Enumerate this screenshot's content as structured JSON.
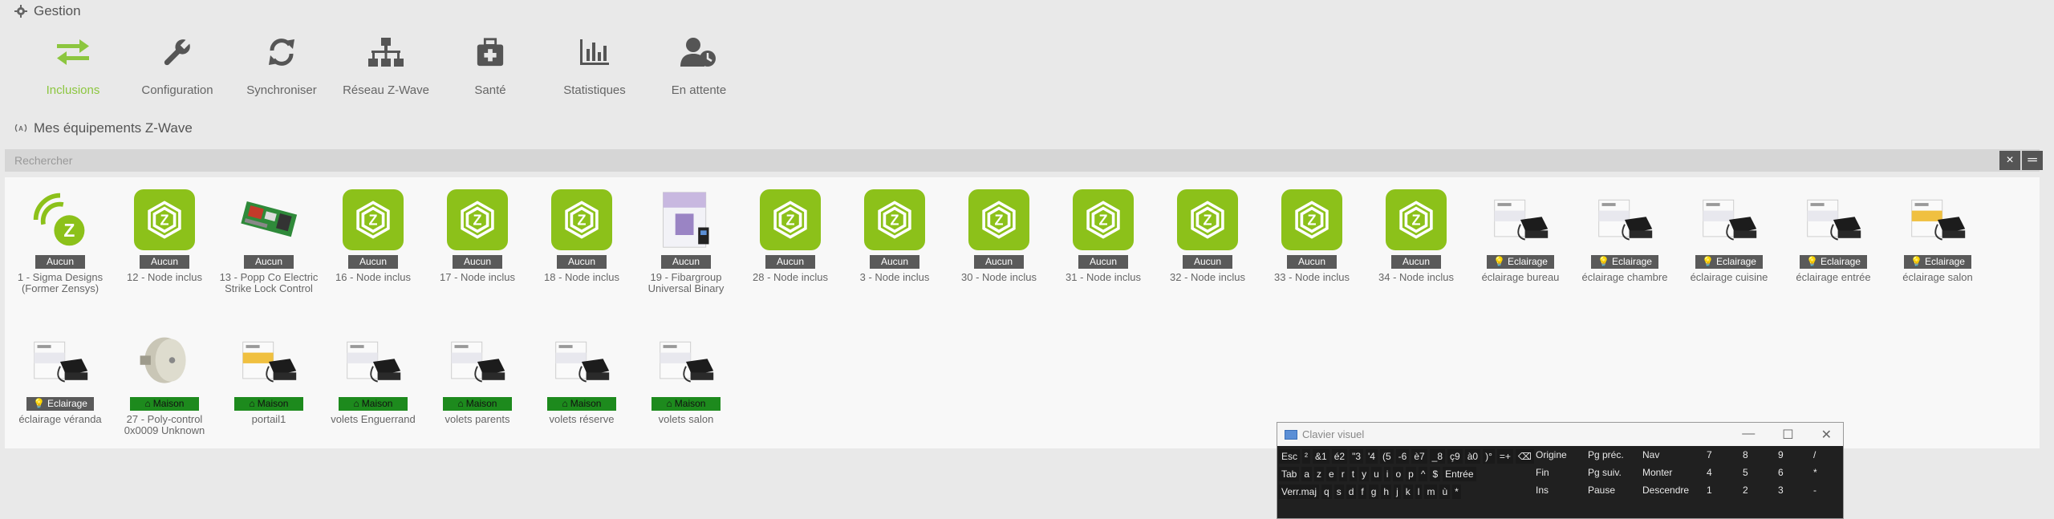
{
  "gestion": {
    "title": "Gestion",
    "items": [
      {
        "label": "Inclusions",
        "icon": "arrows-exchange-icon",
        "active": true
      },
      {
        "label": "Configuration",
        "icon": "wrench-icon"
      },
      {
        "label": "Synchroniser",
        "icon": "sync-icon"
      },
      {
        "label": "Réseau Z-Wave",
        "icon": "network-icon"
      },
      {
        "label": "Santé",
        "icon": "medkit-icon"
      },
      {
        "label": "Statistiques",
        "icon": "bar-chart-icon"
      },
      {
        "label": "En attente",
        "icon": "user-clock-icon"
      }
    ]
  },
  "equipements": {
    "title": "Mes équipements Z-Wave",
    "search_placeholder": "Rechercher",
    "clear_icon": "×",
    "menu_icon": "═"
  },
  "devices_row1": [
    {
      "name": "1 - Sigma Designs (Former Zensys)",
      "badge": "Aucun",
      "img": "sigma"
    },
    {
      "name": "12 - Node inclus",
      "badge": "Aucun",
      "img": "zwave"
    },
    {
      "name": "13 - Popp Co Electric Strike Lock Control",
      "badge": "Aucun",
      "img": "pcb"
    },
    {
      "name": "16 - Node inclus",
      "badge": "Aucun",
      "img": "zwave"
    },
    {
      "name": "17 - Node inclus",
      "badge": "Aucun",
      "img": "zwave"
    },
    {
      "name": "18 - Node inclus",
      "badge": "Aucun",
      "img": "zwave"
    },
    {
      "name": "19 - Fibargroup Universal Binary",
      "badge": "Aucun",
      "img": "fibaro-box"
    },
    {
      "name": "28 - Node inclus",
      "badge": "Aucun",
      "img": "zwave"
    },
    {
      "name": "3 - Node inclus",
      "badge": "Aucun",
      "img": "zwave"
    },
    {
      "name": "30 - Node inclus",
      "badge": "Aucun",
      "img": "zwave"
    },
    {
      "name": "31 - Node inclus",
      "badge": "Aucun",
      "img": "zwave"
    },
    {
      "name": "32 - Node inclus",
      "badge": "Aucun",
      "img": "zwave"
    },
    {
      "name": "33 - Node inclus",
      "badge": "Aucun",
      "img": "zwave"
    },
    {
      "name": "34 - Node inclus",
      "badge": "Aucun",
      "img": "zwave"
    },
    {
      "name": "éclairage bureau",
      "badge": "Eclairage",
      "img": "module"
    },
    {
      "name": "éclairage chambre",
      "badge": "Eclairage",
      "img": "module"
    },
    {
      "name": "éclairage cuisine",
      "badge": "Eclairage",
      "img": "module"
    },
    {
      "name": "éclairage entrée",
      "badge": "Eclairage",
      "img": "module"
    },
    {
      "name": "éclairage salon",
      "badge": "Eclairage",
      "img": "module-yellow"
    }
  ],
  "devices_row2": [
    {
      "name": "éclairage véranda",
      "badge": "Eclairage",
      "img": "module"
    },
    {
      "name": "27 - Poly-control 0x0009 Unknown",
      "badge": "Maison",
      "img": "lock"
    },
    {
      "name": "portail1",
      "badge": "Maison",
      "img": "module-yellow"
    },
    {
      "name": "volets Enguerrand",
      "badge": "Maison",
      "img": "module"
    },
    {
      "name": "volets parents",
      "badge": "Maison",
      "img": "module"
    },
    {
      "name": "volets réserve",
      "badge": "Maison",
      "img": "module"
    },
    {
      "name": "volets salon",
      "badge": "Maison",
      "img": "module"
    }
  ],
  "keyboard": {
    "title": "Clavier visuel",
    "row1": [
      "Esc",
      "²",
      "&1",
      "é2",
      "\"3",
      "'4",
      "(5",
      "-6",
      "è7",
      "_8",
      "ç9",
      "à0",
      ")°",
      "=+",
      "⌫"
    ],
    "row2": [
      "Tab",
      "a",
      "z",
      "e",
      "r",
      "t",
      "y",
      "u",
      "i",
      "o",
      "p",
      "^",
      "$",
      "Entrée"
    ],
    "row3": [
      "Verr.maj",
      "q",
      "s",
      "d",
      "f",
      "g",
      "h",
      "j",
      "k",
      "l",
      "m",
      "ù",
      "*"
    ],
    "nav": [
      [
        "Origine",
        "Pg préc.",
        "Nav"
      ],
      [
        "Fin",
        "Pg suiv.",
        "Monter"
      ],
      [
        "Ins",
        "Pause",
        "Descendre"
      ]
    ],
    "numpad": [
      [
        "7",
        "8",
        "9",
        "/"
      ],
      [
        "4",
        "5",
        "6",
        "*"
      ],
      [
        "1",
        "2",
        "3",
        "-"
      ]
    ]
  },
  "colors": {
    "accent_green": "#8cc63f",
    "zwave_tile": "#8cc11a",
    "badge_gray": "#5a5a5a",
    "badge_maison": "#1d8a1d"
  }
}
